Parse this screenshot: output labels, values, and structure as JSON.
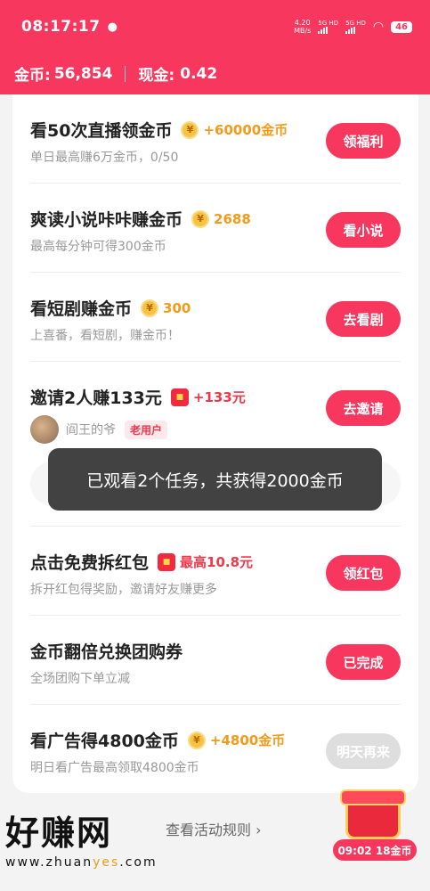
{
  "status_bar": {
    "time": "08:17:17",
    "speed_value": "4.20",
    "speed_unit": "MB/s",
    "signal1": "5G HD",
    "signal2": "5G HD",
    "battery": "46"
  },
  "header": {
    "coins_label": "金币:",
    "coins_value": "56,854",
    "cash_label": "现金:",
    "cash_value": "0.42"
  },
  "tasks": [
    {
      "title": "看50次直播领金币",
      "icon": "coin-icon",
      "reward": "+60000金币",
      "subtitle": "单日最高赚6万金币，0/50",
      "button": "领福利"
    },
    {
      "title": "爽读小说咔咔赚金币",
      "icon": "coin-icon",
      "reward": "2688",
      "subtitle": "最高每分钟可得300金币",
      "button": "看小说"
    },
    {
      "title": "看短剧赚金币",
      "icon": "coin-icon",
      "reward": "300",
      "subtitle": "上喜番，看短剧，赚金币！",
      "button": "去看剧"
    },
    {
      "title": "邀请2人赚133元",
      "icon": "red-packet-icon",
      "reward": "+133元",
      "user_name": "阎王的爷",
      "user_tag": "老用户",
      "button": "去邀请"
    },
    {
      "title": "点击免费拆红包",
      "icon": "red-packet-icon",
      "reward": "最高10.8元",
      "subtitle": "拆开红包得奖励，邀请好友赚更多",
      "button": "领红包"
    },
    {
      "title": "金币翻倍兑换团购券",
      "subtitle": "全场团购下单立减",
      "button": "已完成"
    },
    {
      "title": "看广告得4800金币",
      "icon": "coin-icon",
      "reward": "+4800金币",
      "subtitle": "明日看广告最高领取4800金币",
      "button": "明天再来"
    }
  ],
  "toast": "已观看2个任务，共获得2000金币",
  "footer": {
    "rules_link": "查看活动规则 ›",
    "gift_timer": "09:02 18金币"
  },
  "watermark": {
    "brand": "好赚网",
    "url_a": "www.zhuan",
    "url_b": "yes",
    "url_c": ".com"
  },
  "colors": {
    "brand": "#f7375d",
    "gold": "#f29b1b",
    "red": "#f0384a"
  }
}
